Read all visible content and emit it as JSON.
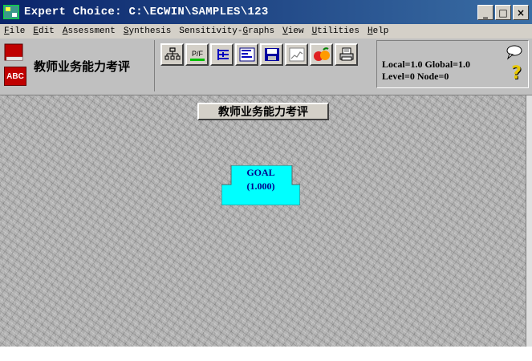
{
  "window": {
    "title": "Expert Choice: C:\\ECWIN\\SAMPLES\\123",
    "controls": [
      "_",
      "□",
      "×"
    ],
    "title_bar_color": "#0a246a"
  },
  "menu": [
    {
      "mnemonic": "F",
      "rest": "ile"
    },
    {
      "mnemonic": "E",
      "rest": "dit"
    },
    {
      "mnemonic": "A",
      "rest": "ssessment"
    },
    {
      "mnemonic": "S",
      "rest": "ynthesis"
    },
    {
      "pre": "Sensitivity-",
      "mnemonic": "G",
      "rest": "raphs"
    },
    {
      "mnemonic": "V",
      "rest": "iew"
    },
    {
      "mnemonic": "U",
      "rest": "tilities"
    },
    {
      "mnemonic": "H",
      "rest": "elp"
    }
  ],
  "toolbar": {
    "model_name": "教师业务能力考评",
    "abc_label": "ABC",
    "tools": [
      {
        "icon": "hierarchy-icon"
      },
      {
        "icon": "pf-icon",
        "label": "P/F"
      },
      {
        "icon": "tree-view-icon"
      },
      {
        "icon": "bar-list-icon"
      },
      {
        "icon": "save-disk-icon"
      },
      {
        "icon": "line-chart-icon"
      },
      {
        "icon": "apple-orange-icon"
      },
      {
        "icon": "printer-icon"
      }
    ]
  },
  "status": {
    "line1": "Local=1.0 Global=1.0",
    "line2": "Level=0  Node=0"
  },
  "canvas": {
    "title": "教师业务能力考评",
    "goal": {
      "label": "GOAL",
      "value": "(1.000)",
      "fill_color": "#00ffff"
    }
  }
}
